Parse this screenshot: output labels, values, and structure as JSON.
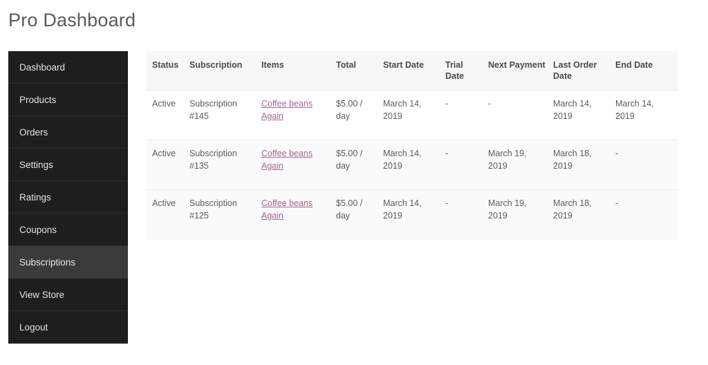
{
  "page": {
    "title": "Pro Dashboard"
  },
  "sidebar": {
    "items": [
      {
        "label": "Dashboard",
        "active": false
      },
      {
        "label": "Products",
        "active": false
      },
      {
        "label": "Orders",
        "active": false
      },
      {
        "label": "Settings",
        "active": false
      },
      {
        "label": "Ratings",
        "active": false
      },
      {
        "label": "Coupons",
        "active": false
      },
      {
        "label": "Subscriptions",
        "active": true
      },
      {
        "label": "View Store",
        "active": false
      },
      {
        "label": "Logout",
        "active": false
      }
    ],
    "active_item": "Subscriptions"
  },
  "table": {
    "columns": [
      "Status",
      "Subscription",
      "Items",
      "Total",
      "Start Date",
      "Trial Date",
      "Next Payment",
      "Last Order Date",
      "End Date"
    ],
    "rows": [
      {
        "status": "Active",
        "subscription": "Subscription #145",
        "items": "Coffee beans Again",
        "total": "$5.00 / day",
        "start_date": "March 14, 2019",
        "trial_date": "-",
        "next_payment": "-",
        "last_order_date": "March 14, 2019",
        "end_date": "March 14, 2019"
      },
      {
        "status": "Active",
        "subscription": "Subscription #135",
        "items": "Coffee beans Again",
        "total": "$5.00 / day",
        "start_date": "March 14, 2019",
        "trial_date": "-",
        "next_payment": "March 19, 2019",
        "last_order_date": "March 18, 2019",
        "end_date": "-"
      },
      {
        "status": "Active",
        "subscription": "Subscription #125",
        "items": "Coffee beans Again",
        "total": "$5.00 / day",
        "start_date": "March 14, 2019",
        "trial_date": "-",
        "next_payment": "March 19, 2019",
        "last_order_date": "March 18, 2019",
        "end_date": "-"
      }
    ]
  },
  "colors": {
    "sidebar_bg": "#1e1e1e",
    "sidebar_active_bg": "#3b3b3b",
    "link": "#a46497",
    "header_bg": "#f7f7f7",
    "alt_row_bg": "#fafafa"
  }
}
